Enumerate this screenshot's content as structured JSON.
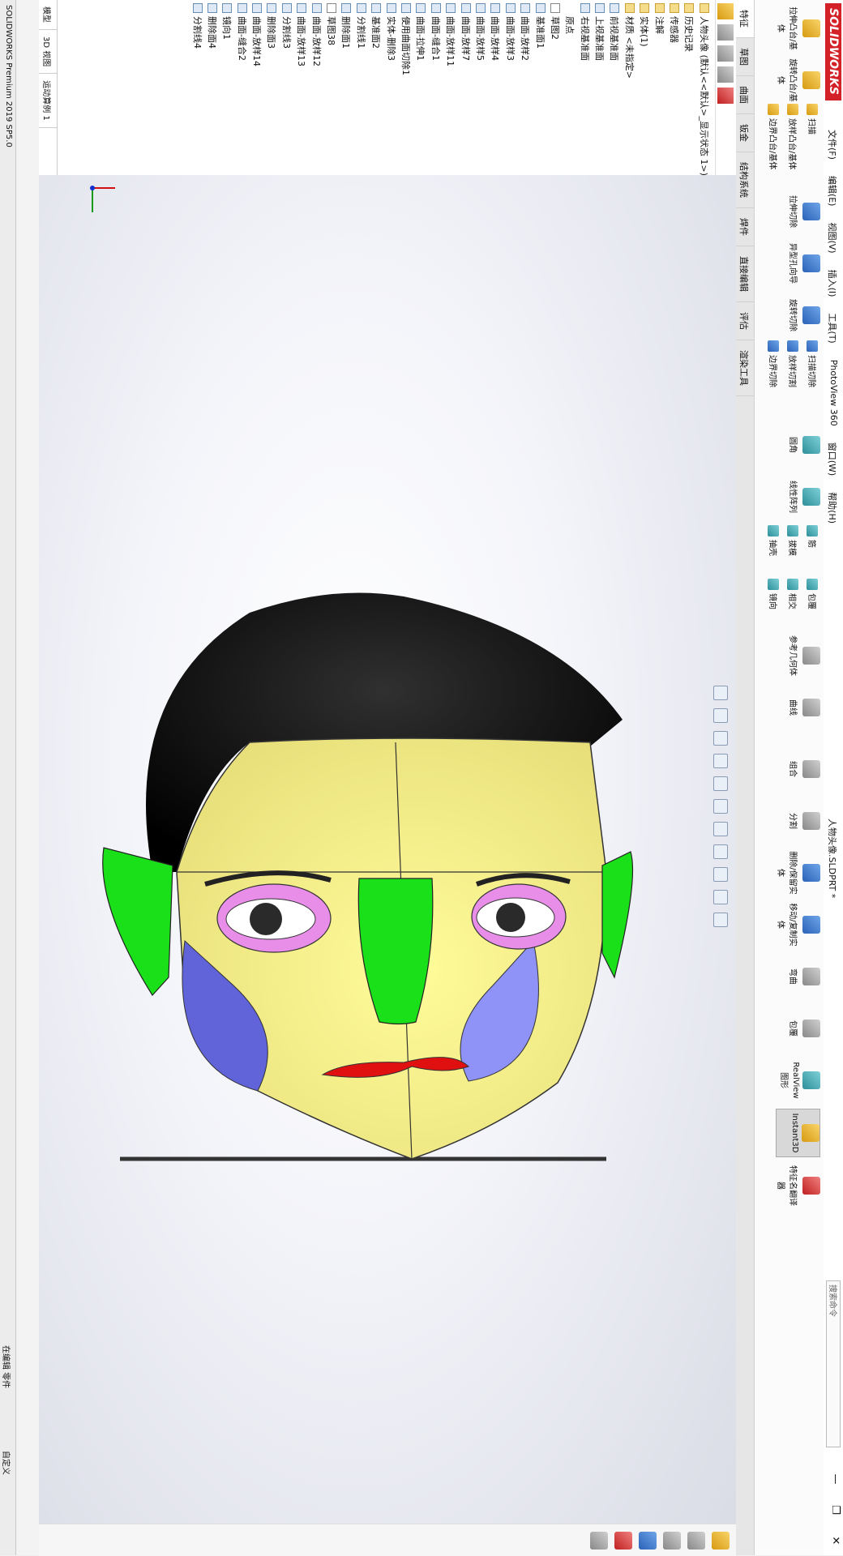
{
  "app": {
    "brand": "SOLIDWORKS",
    "menus": [
      "文件(F)",
      "编辑(E)",
      "视图(V)",
      "插入(I)",
      "工具(T)",
      "PhotoView 360",
      "窗口(W)",
      "帮助(H)"
    ],
    "document_title": "人物头像.SLDPRT *",
    "search_placeholder": "搜索命令",
    "window_controls": [
      "—",
      "❐",
      "✕"
    ]
  },
  "ribbon": {
    "big_buttons": [
      "拉伸凸台/基体",
      "旋转凸台/基体",
      "扫描",
      "放样凸台/基体",
      "边界凸台/基体",
      "拉伸切除",
      "异型孔向导",
      "旋转切除",
      "扫描切除",
      "放样切割",
      "边界切除",
      "圆角",
      "线性阵列",
      "筋",
      "拔模",
      "抽壳",
      "包覆",
      "相交",
      "镜向",
      "参考几何体",
      "曲线",
      "组合",
      "分割",
      "删除/保留实体",
      "移动/复制实体",
      "弯曲",
      "包覆",
      "RealView 图形",
      "Instant3D",
      "特征名翻译器"
    ]
  },
  "tabs": [
    "特征",
    "草图",
    "曲面",
    "钣金",
    "结构系统",
    "焊件",
    "直接编辑",
    "评估",
    "渲染工具"
  ],
  "feature_tree": {
    "root": "人物头像 (默认<<默认>_显示状态 1>)",
    "items": [
      "历史记录",
      "传感器",
      "注解",
      "实体(1)",
      "材质 <未指定>",
      "前视基准面",
      "上视基准面",
      "右视基准面",
      "原点",
      "草图2",
      "基准面1",
      "曲面-放样2",
      "曲面-放样3",
      "曲面-放样4",
      "曲面-放样5",
      "曲面-放样7",
      "曲面-放样11",
      "曲面-缝合1",
      "曲面-拉伸1",
      "使用曲面切除1",
      "实体-删除3",
      "基准面2",
      "分割线1",
      "删除面1",
      "草图38",
      "曲面-放样12",
      "曲面-放样13",
      "分割线3",
      "删除面3",
      "曲面-放样14",
      "曲面-缝合2",
      "镜向1",
      "删除面4",
      "分割线4"
    ]
  },
  "left_bottom_tabs": [
    "模型",
    "3D 视图",
    "运动算例 1"
  ],
  "status": {
    "left": "SOLIDWORKS Premium 2019 SP5.0",
    "mode": "在编辑 零件",
    "custom": "自定义"
  },
  "colors": {
    "hair": "#0a0a0a",
    "face": "#f7f08a",
    "ears_nose": "#19e019",
    "cheeks": "#6c6fe0",
    "eye_shadow": "#e88ee8",
    "lips": "#e01010",
    "brand_red": "#d42027"
  }
}
